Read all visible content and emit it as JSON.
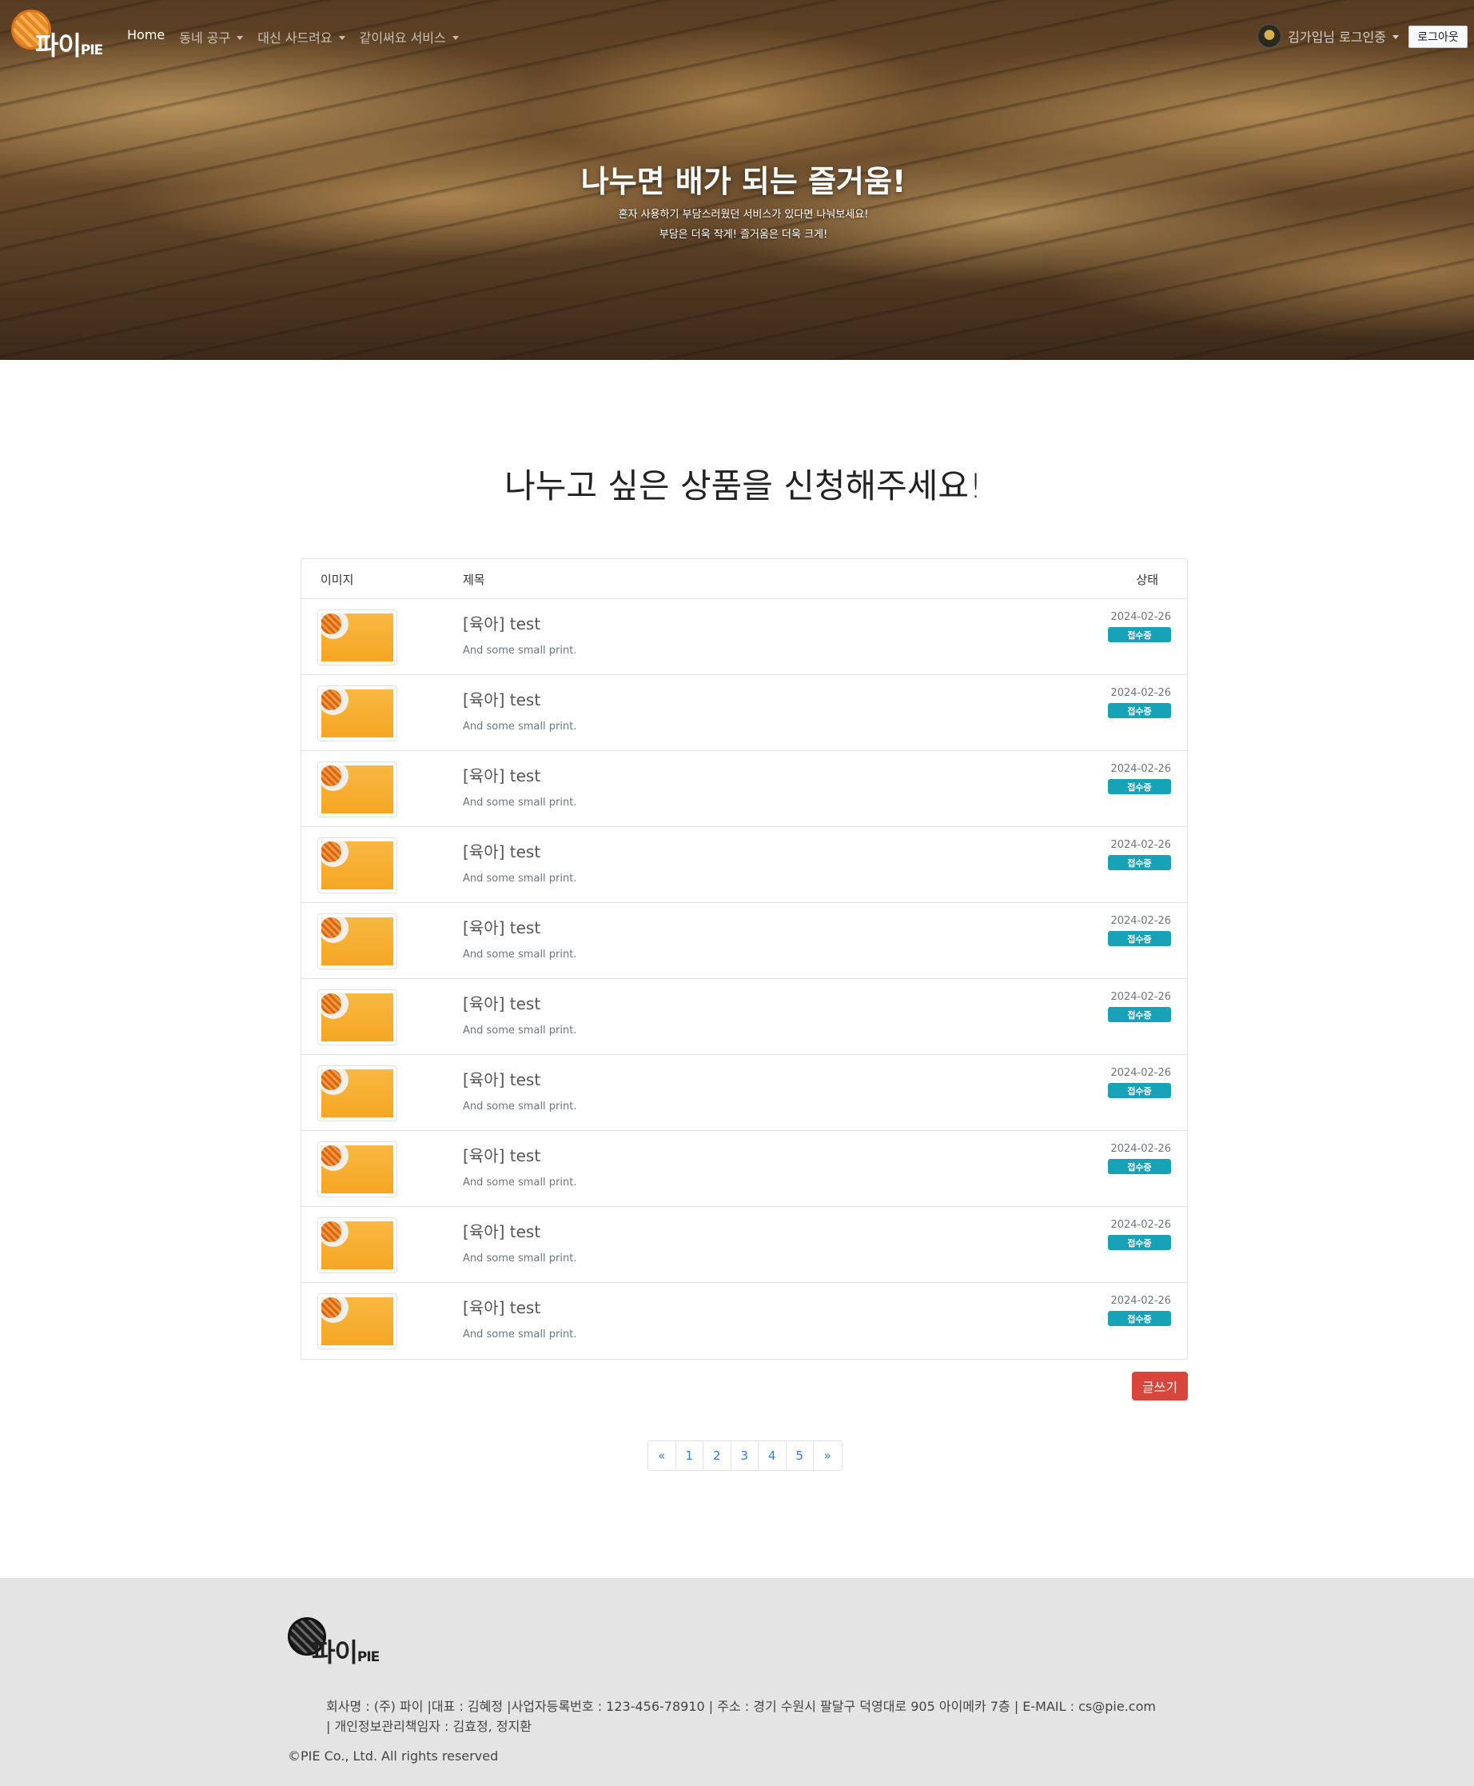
{
  "nav": {
    "logo_text": "파이",
    "logo_small": "PIE",
    "links": [
      {
        "label": "Home",
        "active": true
      },
      {
        "label": "동네 공구",
        "dropdown": true
      },
      {
        "label": "대신 사드려요",
        "dropdown": true
      },
      {
        "label": "같이써요 서비스",
        "dropdown": true
      }
    ],
    "user_label": "김가입님 로그인중",
    "logout_label": "로그아웃"
  },
  "hero": {
    "title": "나누면 배가 되는 즐거움!",
    "subtitle_line1": "혼자 사용하기 부담스러웠던 서비스가 있다면 나눠보세요!",
    "subtitle_line2": "부담은 더욱 작게! 즐거움은 더욱 크게!"
  },
  "main": {
    "heading": "나누고 싶은 상품을 신청해주세요!",
    "columns": {
      "image": "이미지",
      "title": "제목",
      "status": "상태"
    },
    "rows": [
      {
        "title": "[육아] test",
        "small": "And some small print.",
        "date": "2024-02-26",
        "status": "접수중"
      },
      {
        "title": "[육아] test",
        "small": "And some small print.",
        "date": "2024-02-26",
        "status": "접수중"
      },
      {
        "title": "[육아] test",
        "small": "And some small print.",
        "date": "2024-02-26",
        "status": "접수중"
      },
      {
        "title": "[육아] test",
        "small": "And some small print.",
        "date": "2024-02-26",
        "status": "접수중"
      },
      {
        "title": "[육아] test",
        "small": "And some small print.",
        "date": "2024-02-26",
        "status": "접수중"
      },
      {
        "title": "[육아] test",
        "small": "And some small print.",
        "date": "2024-02-26",
        "status": "접수중"
      },
      {
        "title": "[육아] test",
        "small": "And some small print.",
        "date": "2024-02-26",
        "status": "접수중"
      },
      {
        "title": "[육아] test",
        "small": "And some small print.",
        "date": "2024-02-26",
        "status": "접수중"
      },
      {
        "title": "[육아] test",
        "small": "And some small print.",
        "date": "2024-02-26",
        "status": "접수중"
      },
      {
        "title": "[육아] test",
        "small": "And some small print.",
        "date": "2024-02-26",
        "status": "접수중"
      }
    ],
    "write_label": "글쓰기",
    "pagination": [
      "«",
      "1",
      "2",
      "3",
      "4",
      "5",
      "»"
    ]
  },
  "footer": {
    "logo_text": "파이",
    "logo_small": "PIE",
    "info_line1": "회사명 : (주) 파이 |대표 : 김혜정 |사업자등록번호 : 123-456-78910 | 주소 : 경기 수원시 팔달구 덕영대로 905 아이메카 7층 | E-MAIL : cs@pie.com",
    "info_line2": "| 개인정보관리책임자 : 김효정, 정지환",
    "copyright": "©PIE Co., Ltd. All rights reserved"
  },
  "colors": {
    "badge": "#17a2b8",
    "write_button": "#d9453a",
    "page_link": "#2b7de9",
    "footer_bg": "#e4e4e4"
  }
}
